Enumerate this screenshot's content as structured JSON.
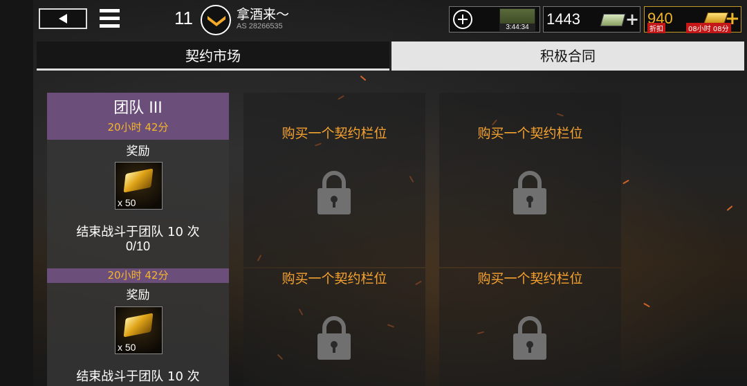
{
  "header": {
    "player_level": "11",
    "player_name": "拿酒来～",
    "player_id": "AS 28266535",
    "tank_timer": "3:44:34",
    "silver": "1443",
    "gold": "940",
    "discount_label": "折扣",
    "discount_timer": "08小时 08分"
  },
  "tabs": [
    {
      "label": "契约市场",
      "active": false
    },
    {
      "label": "积极合同",
      "active": true
    }
  ],
  "contracts": [
    {
      "title": "团队 III",
      "time_left": "20小时 42分",
      "reward_label": "奖励",
      "reward_qty": "x 50",
      "objective": "结束战斗于团队 10 次",
      "progress": "0/10"
    },
    {
      "time_left": "20小时 42分",
      "reward_label": "奖励",
      "reward_qty": "x 50",
      "objective": "结束战斗于团队 10 次"
    }
  ],
  "locked_slots": [
    {
      "label": "购买一个契约栏位"
    },
    {
      "label": "购买一个契约栏位"
    },
    {
      "label": "购买一个契约栏位"
    },
    {
      "label": "购买一个契约栏位"
    }
  ],
  "colors": {
    "accent_orange": "#f6a230",
    "header_purple": "#6b4e7a",
    "gold": "#f0b528",
    "discount_red": "#c41818"
  }
}
